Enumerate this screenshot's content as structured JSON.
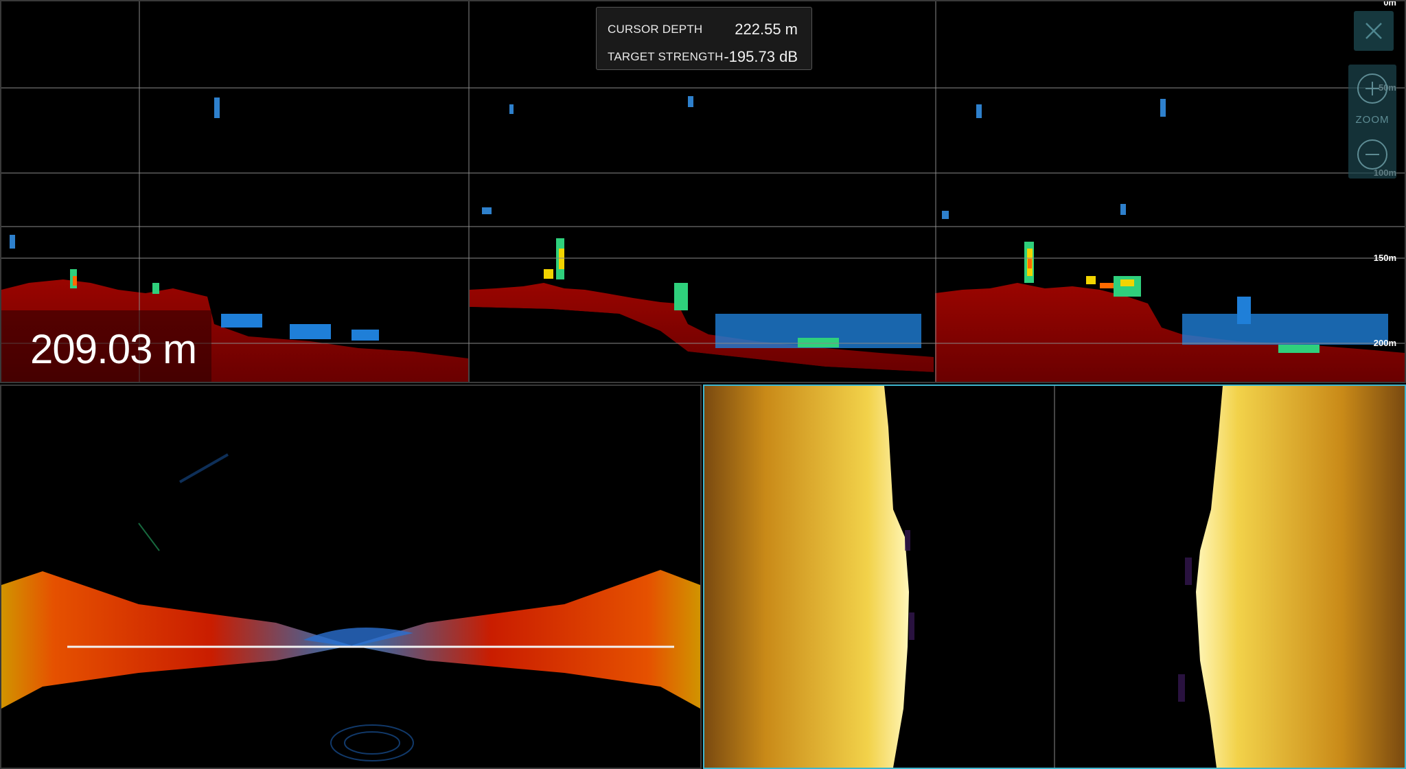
{
  "readout": {
    "cursor_depth_label": "CURSOR DEPTH",
    "cursor_depth_value": "222.55 m",
    "target_strength_label": "TARGET STRENGTH",
    "target_strength_value": "-195.73 dB"
  },
  "depth_display": "209.03 m",
  "zoom": {
    "label": "ZOOM",
    "in_icon": "zoom-in-icon",
    "out_icon": "zoom-out-icon"
  },
  "close_icon": "close-icon",
  "depth_scale": [
    "0m",
    "50m",
    "100m",
    "150m",
    "200m"
  ],
  "colors": {
    "bottom_red": "#8b0000",
    "scan_gold": "#d9a21c",
    "accent_cyan": "#3fb6cf",
    "panel_bg": "#1c1c1c"
  }
}
